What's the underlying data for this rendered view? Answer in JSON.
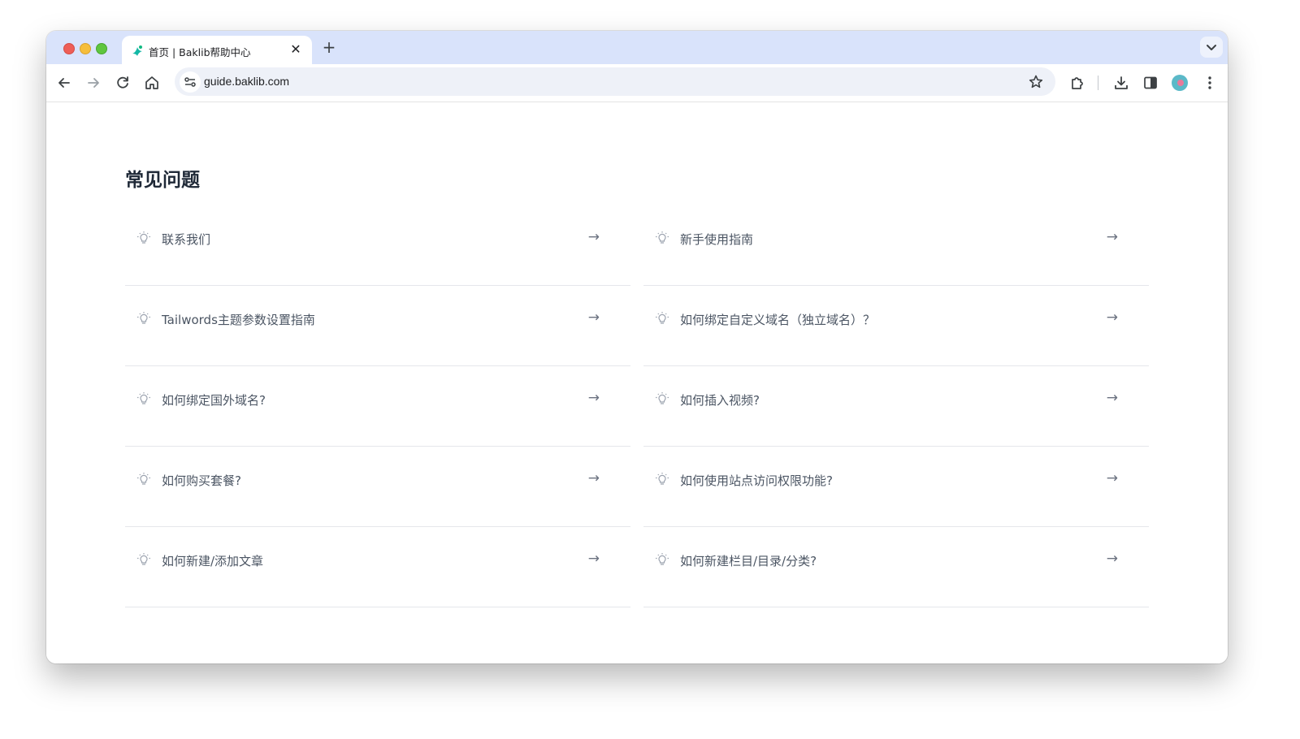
{
  "browser": {
    "tab": {
      "title": "首页 | Baklib帮助中心",
      "close_glyph": "✕"
    },
    "new_tab_glyph": "+",
    "url": "guide.baklib.com"
  },
  "page": {
    "title": "常见问题",
    "arrow_glyph": "→",
    "faq_items": [
      {
        "label": "联系我们"
      },
      {
        "label": "新手使用指南"
      },
      {
        "label": "Tailwords主题参数设置指南"
      },
      {
        "label": "如何绑定自定义域名（独立域名）？"
      },
      {
        "label": "如何绑定国外域名?"
      },
      {
        "label": "如何插入视频?"
      },
      {
        "label": "如何购买套餐?"
      },
      {
        "label": "如何使用站点访问权限功能?"
      },
      {
        "label": "如何新建/添加文章"
      },
      {
        "label": "如何新建栏目/目录/分类?"
      }
    ]
  },
  "colors": {
    "tabbar_bg": "#d9e3fb",
    "text_primary": "#1f2937",
    "text_secondary": "#4b5563",
    "divider": "#e5e7eb"
  }
}
